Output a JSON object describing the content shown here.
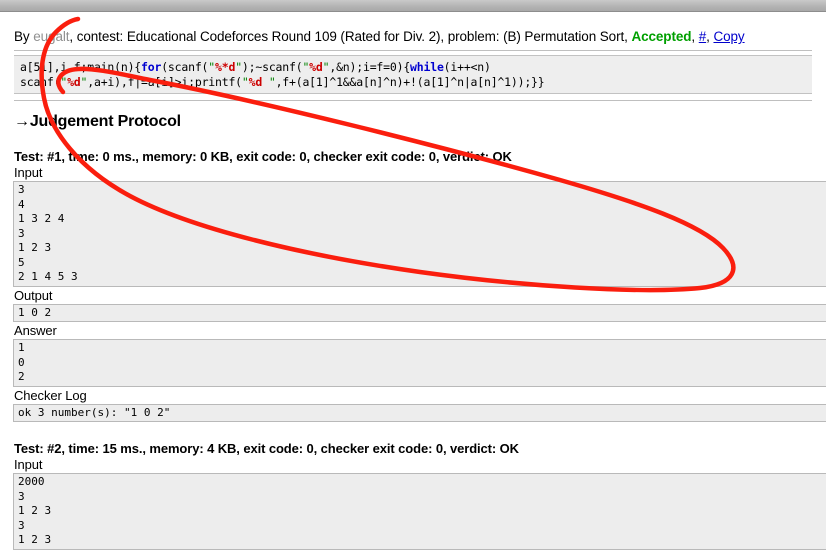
{
  "window": {
    "chrome_bar": "browser-top-chrome"
  },
  "byline": {
    "prefix": "By ",
    "author": "eugalt",
    "contest_part": ", contest: Educational Codeforces Round 109 (Rated for Div. 2), problem: (B) Permutation Sort, ",
    "verdict": "Accepted",
    "sep1": ", ",
    "hash_link": "#",
    "sep2": ", ",
    "copy_link": "Copy"
  },
  "code": {
    "line1_a": "a[51],i,f;main(n){",
    "line1_kw": "for",
    "line1_b": "(scanf(",
    "line1_s1_q1": "\"",
    "line1_s1_fmt": "%*d",
    "line1_s1_q2": "\"",
    "line1_c": ");~scanf(",
    "line1_s2_q1": "\"",
    "line1_s2_fmt": "%d",
    "line1_s2_q2": "\"",
    "line1_d": ",&n);i=f=0){",
    "line1_kw2": "while",
    "line1_e": "(i++<n)",
    "line2_a": "scanf(",
    "line2_s1_q1": "\"",
    "line2_s1_fmt": "%d",
    "line2_s1_q2": "\"",
    "line2_b": ",a+i),f|=a[i]>i;printf(",
    "line2_s2_q1": "\"",
    "line2_s2_fmt": "%d ",
    "line2_s2_q2": "\"",
    "line2_c": ",f+(a[1]^1&&a[n]^n)+!(a[1]^n|a[n]^1));}}"
  },
  "protocol": {
    "arrow": "→",
    "heading": "Judgement Protocol"
  },
  "tests": [
    {
      "header": "Test: #1, time: 0 ms., memory: 0 KB, exit code: 0, checker exit code: 0, verdict: OK",
      "input_label": "Input",
      "input": "3\n4\n1 3 2 4\n3\n1 2 3\n5\n2 1 4 5 3",
      "output_label": "Output",
      "output": "1 0 2",
      "answer_label": "Answer",
      "answer": "1\n0\n2",
      "checker_label": "Checker Log",
      "checker": "ok 3 number(s): \"1 0 2\""
    },
    {
      "header": "Test: #2, time: 15 ms., memory: 4 KB, exit code: 0, checker exit code: 0, verdict: OK",
      "input_label": "Input",
      "input": "2000\n3\n1 2 3\n3\n1 2 3"
    }
  ],
  "annotation": {
    "name": "red-ellipse-highlight",
    "color": "#fa1e0e",
    "stroke_width": 4.5
  }
}
